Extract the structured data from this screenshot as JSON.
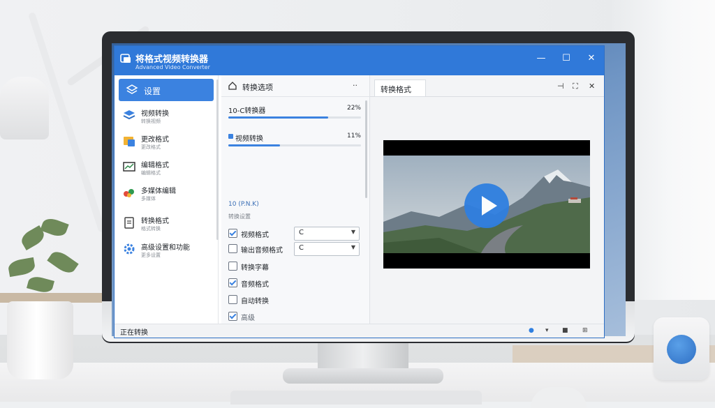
{
  "window": {
    "title": "将格式视频转换器",
    "subtitle": "Advanced Video Converter",
    "minimize": "—",
    "maximize": "☐",
    "close": "✕"
  },
  "sidebar": {
    "active": "设置",
    "items": [
      {
        "label": "视频转换",
        "sub": "转换视频"
      },
      {
        "label": "更改格式",
        "sub": "更改格式"
      },
      {
        "label": "编辑格式",
        "sub": "编辑格式"
      },
      {
        "label": "多媒体编辑",
        "sub": "多媒体"
      },
      {
        "label": "转换格式",
        "sub": "格式转换"
      },
      {
        "label": "高级设置和功能",
        "sub": "更多设置"
      }
    ]
  },
  "middle": {
    "header": "转换选项",
    "more": "··",
    "progress": [
      {
        "label": "10-C转换器",
        "pct": "22%",
        "value": 0.75
      },
      {
        "label": "视频转换",
        "pct": "11%",
        "value": 0.39
      }
    ],
    "link": "10 (P.N.K)",
    "sublabel": "转换设置",
    "options": [
      {
        "label": "视频格式",
        "checked": true,
        "select": "C"
      },
      {
        "label": "输出音频格式",
        "checked": false,
        "select": "C"
      },
      {
        "label": "转换字幕",
        "checked": false
      },
      {
        "label": "音频格式",
        "checked": true
      },
      {
        "label": "自动转换",
        "checked": false
      },
      {
        "label": "高级",
        "checked": true
      }
    ]
  },
  "preview": {
    "tab": "转换格式",
    "pin": "⊣",
    "expand": "⛶",
    "close": "✕"
  },
  "status": {
    "label": "正在转换",
    "icons": [
      "●",
      "▾",
      "■",
      "⊞"
    ]
  },
  "colors": {
    "accent": "#3079d9",
    "play": "#2f7fe0"
  }
}
